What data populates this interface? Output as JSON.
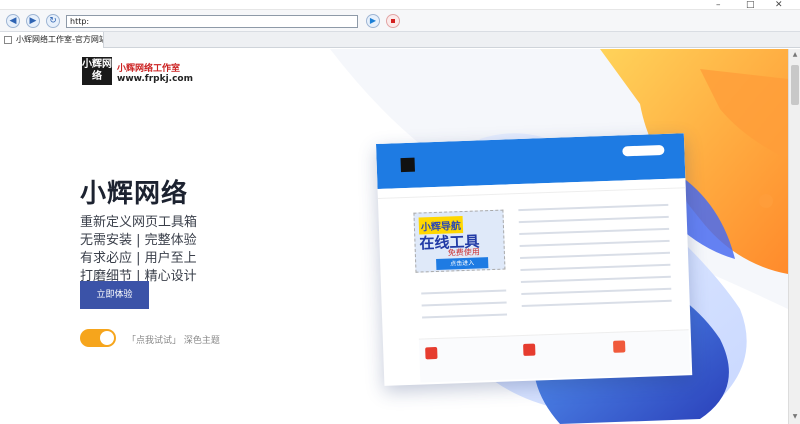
{
  "browser": {
    "address": "http:",
    "tab_title": "小辉网络工作室-官方网站-",
    "window_controls": [
      "–",
      "□",
      "✕"
    ]
  },
  "site": {
    "logo_text": "小辉网络",
    "brand_name": "小辉网络工作室",
    "brand_url": "www.frpkj.com",
    "hero_title": "小辉网络",
    "features": [
      "重新定义网页工具箱",
      "无需安装 | 完整体验",
      "有求必应 | 用户至上",
      "打磨细节 | 精心设计"
    ],
    "cta_label": "立即体验",
    "theme_toggle_label": "「点我试试」 深色主题"
  },
  "mockup": {
    "promo_tag": "小辉导航",
    "promo_big": "在线工具",
    "promo_small": "免费使用",
    "promo_button": "点击进入"
  },
  "colors": {
    "accent": "#3b53a8",
    "orange": "#f6a51c",
    "blue": "#1e7be3"
  }
}
